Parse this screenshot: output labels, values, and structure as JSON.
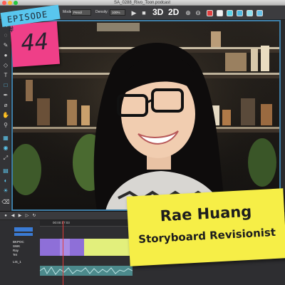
{
  "window": {
    "title": "SA_0288_Rivo_Toon.podcast"
  },
  "toolbar": {
    "mode_label": "Mode:",
    "mode_value": "Pencil",
    "density_label": "Density:",
    "density_value": "100%",
    "view_3d_label": "3D",
    "view_2d_label": "2D",
    "icons": [
      "play-icon",
      "stop-icon",
      "zoom-in-icon",
      "zoom-out-icon"
    ],
    "swatches": [
      "#e04040",
      "#f0f0f0",
      "#5ad3e8",
      "#4fb8e0",
      "#8ee0f0",
      "#66c0e8"
    ]
  },
  "timeline": {
    "ruler_time": "00:00:17:03",
    "tracks": [
      {
        "label": "BKPOC"
      },
      {
        "label": "SWK"
      },
      {
        "label": "Ray"
      },
      {
        "label": "Tet"
      },
      {
        "label": "LIS_1"
      }
    ],
    "clip_colors": {
      "purple": "#8e6fd8",
      "lime": "#e2ef7c",
      "teal": "#4c8a8c"
    }
  },
  "overlay": {
    "episode_label": "EPISODE #",
    "episode_number": "44",
    "guest_name": "Rae Huang",
    "guest_role": "Storyboard Revisionist",
    "colors": {
      "episode_banner": "#59c6ee",
      "episode_note": "#ef3f88",
      "name_note": "#f6ee47"
    }
  }
}
